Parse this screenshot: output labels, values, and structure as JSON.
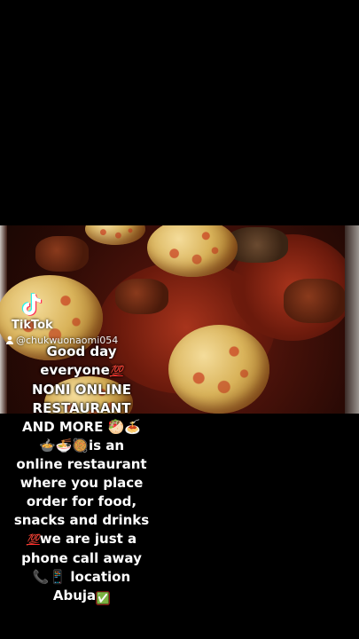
{
  "video": {
    "watermark": {
      "brand": "TikTok",
      "username": "@chukwuonaomi054"
    },
    "caption": {
      "line1": "Good day",
      "line2": "everyone",
      "line2_emoji": "💯",
      "line3": "NONI ONLINE",
      "line4": "RESTAURANT",
      "line5": "AND MORE",
      "line5_emoji": "🥙🍝",
      "line6_emoji": "🍲🍜🥘",
      "line6": "is an",
      "line7": "online restaurant",
      "line8": "where you place",
      "line9": "order for food,",
      "line10": "snacks and drinks",
      "line11_emoji": "💯",
      "line11": "we are just a",
      "line12": "phone call away",
      "line13_emoji": "📞📱",
      "line13": "location",
      "line14": "Abuja",
      "line14_emoji": "✅"
    }
  },
  "colors": {
    "background": "#000000",
    "text": "#ffffff",
    "hundred": "#ff2a2a",
    "check": "#dd2222"
  }
}
